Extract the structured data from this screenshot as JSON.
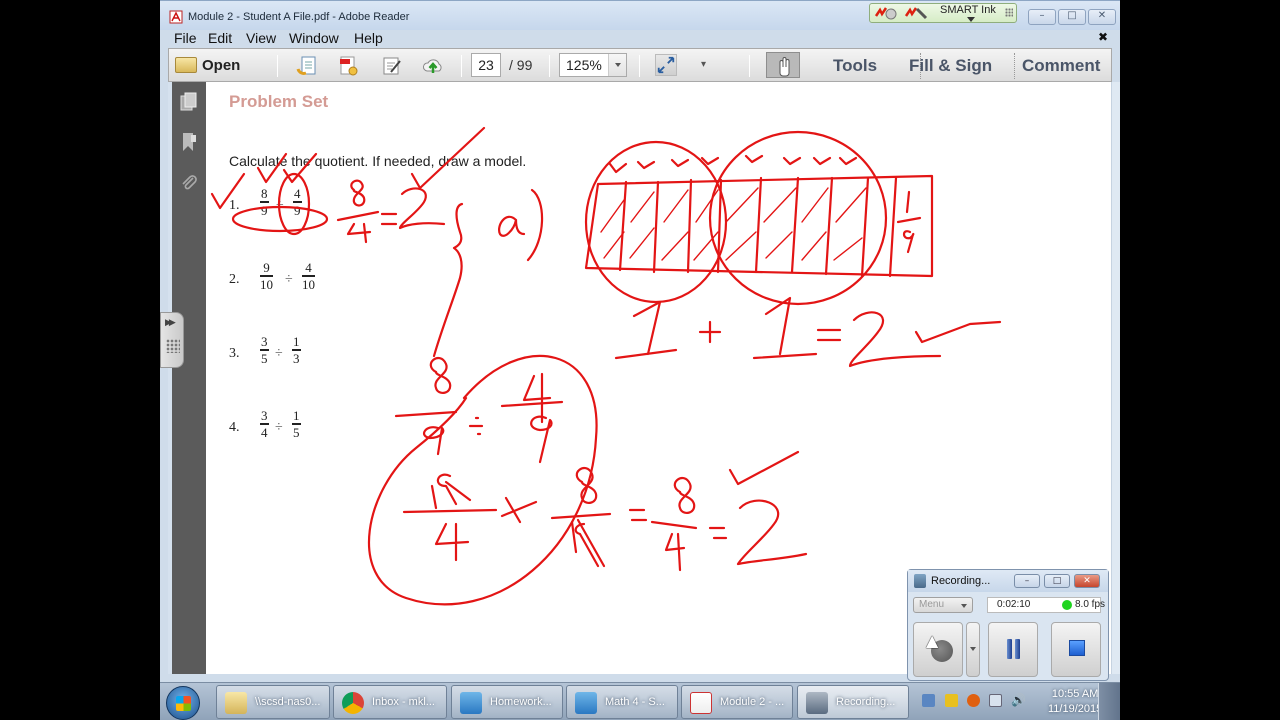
{
  "window": {
    "title": "Module 2 - Student A File.pdf - Adobe Reader",
    "smart_ink_label": "SMART Ink",
    "minimize_glyph": "–",
    "maximize_glyph": "□",
    "close_glyph": "✕"
  },
  "menu": {
    "items": [
      "File",
      "Edit",
      "View",
      "Window",
      "Help"
    ],
    "close_doc_glyph": "✖"
  },
  "toolbar": {
    "open_label": "Open",
    "current_page": "23",
    "total_pages": "/  99",
    "zoom": "125%",
    "more_glyph": "▾",
    "tools_label": "Tools",
    "fill_sign_label": "Fill & Sign",
    "comment_label": "Comment"
  },
  "navpane": {
    "collapse_arrows": "▶▶"
  },
  "document": {
    "heading": "Problem Set",
    "instructions": "Calculate the quotient.  If needed, draw a model.",
    "problems": [
      {
        "number": "1.",
        "a_num": "8",
        "a_den": "9",
        "op": "÷",
        "b_num": "4",
        "b_den": "9"
      },
      {
        "number": "2.",
        "a_num": "9",
        "a_den": "10",
        "op": "÷",
        "b_num": "4",
        "b_den": "10"
      },
      {
        "number": "3.",
        "a_num": "3",
        "a_den": "5",
        "op": "÷",
        "b_num": "1",
        "b_den": "3"
      },
      {
        "number": "4.",
        "a_num": "3",
        "a_den": "4",
        "op": "÷",
        "b_num": "1",
        "b_den": "5"
      }
    ],
    "ink_color": "#e31515",
    "ink_annotations": [
      "8/4 = 2",
      "a)",
      "tape diagram with 9 ninths, 8 shaded, groups of 4 circled, last unit labeled 1/9",
      "1 + 1 = 2",
      "8/9 ÷ 4/9",
      "9/4 × 8/9 = 8/4 = 2"
    ]
  },
  "recorder": {
    "title": "Recording...",
    "menu_label": "Menu",
    "elapsed": "0:02:10",
    "fps": "8.0 fps",
    "status_color": "#1fd41f"
  },
  "taskbar": {
    "items": [
      {
        "label": "\\\\scsd-nas0...",
        "icon": "folder-icon"
      },
      {
        "label": "Inbox - mkl...",
        "icon": "chrome-icon"
      },
      {
        "label": "Homework...",
        "icon": "notebook-icon"
      },
      {
        "label": "Math 4 - S...",
        "icon": "notebook-icon"
      },
      {
        "label": "Module 2 - ...",
        "icon": "pdf-icon"
      },
      {
        "label": "Recording...",
        "icon": "camera-icon"
      }
    ],
    "time": "10:55 AM",
    "date": "11/19/2015"
  }
}
